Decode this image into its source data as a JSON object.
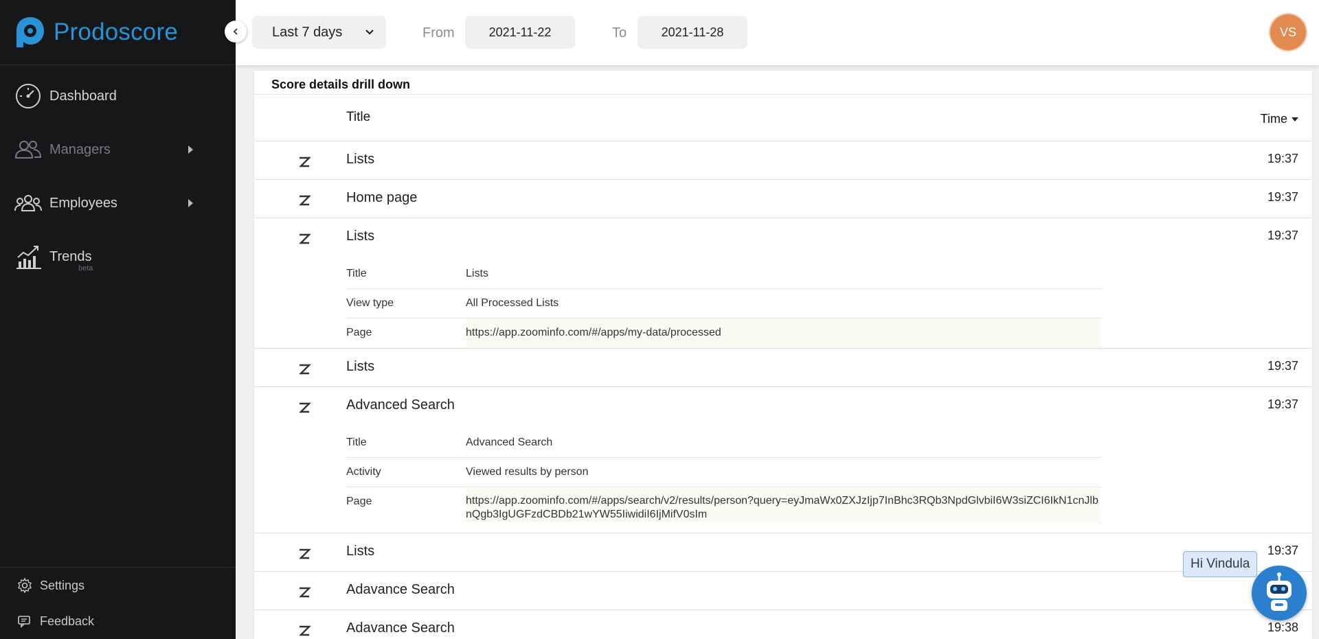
{
  "brand": {
    "name": "Prodoscore",
    "color": "#2a92d6"
  },
  "sidebar": {
    "items": [
      {
        "label": "Dashboard",
        "icon": "speedometer-icon"
      },
      {
        "label": "Managers",
        "icon": "managers-icon"
      },
      {
        "label": "Employees",
        "icon": "employees-icon"
      },
      {
        "label": "Trends",
        "icon": "trends-icon",
        "badge": "beta"
      }
    ],
    "bottom": [
      {
        "label": "Settings",
        "icon": "gear-icon"
      },
      {
        "label": "Feedback",
        "icon": "feedback-icon"
      }
    ]
  },
  "header": {
    "period": "Last 7 days",
    "from_label": "From",
    "from_date": "2021-11-22",
    "to_label": "To",
    "to_date": "2021-11-28",
    "avatar_initials": "VS",
    "avatar_color": "#e28a4f"
  },
  "card": {
    "title": "Score details drill down",
    "columns": {
      "title": "Title",
      "time": "Time"
    },
    "rows": [
      {
        "title": "Lists",
        "time": "19:37"
      },
      {
        "title": "Home page",
        "time": "19:37"
      },
      {
        "title": "Lists",
        "time": "19:37",
        "details": [
          {
            "key": "Title",
            "value": "Lists"
          },
          {
            "key": "View type",
            "value": "All Processed Lists"
          },
          {
            "key": "Page",
            "value": "https://app.zoominfo.com/#/apps/my-data/processed"
          }
        ]
      },
      {
        "title": "Lists",
        "time": "19:37"
      },
      {
        "title": "Advanced Search",
        "time": "19:37",
        "details": [
          {
            "key": "Title",
            "value": "Advanced Search"
          },
          {
            "key": "Activity",
            "value": "Viewed results by person"
          },
          {
            "key": "Page",
            "value": "https://app.zoominfo.com/#/apps/search/v2/results/person?query=eyJmaWx0ZXJzIjp7InBhc3RQb3NpdGlvbiI6W3siZCI6IkN1cnJlbnQgb3IgUGFzdCBDb21wYW55IiwidiI6IjMifV0sIm"
          }
        ]
      },
      {
        "title": "Lists",
        "time": "19:37"
      },
      {
        "title": "Adavance Search",
        "time": ""
      },
      {
        "title": "Adavance Search",
        "time": "19:38"
      }
    ]
  },
  "chat": {
    "greeting": "Hi Vindula"
  }
}
